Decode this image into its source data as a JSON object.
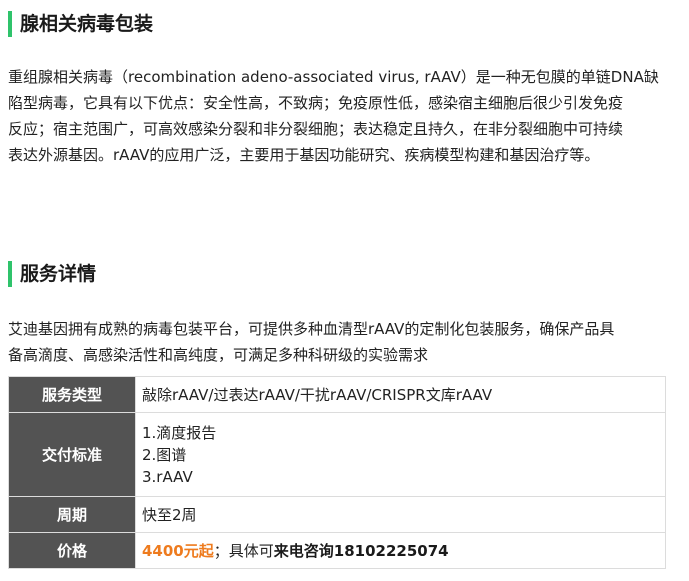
{
  "intro": {
    "title": "腺相关病毒包装",
    "paragraph_lines": [
      "重组腺相关病毒（recombination adeno-associated virus, rAAV）是一种无包膜的单链DNA缺",
      "陷型病毒，它具有以下优点：安全性高，不致病；免疫原性低，感染宿主细胞后很少引发免疫",
      "反应；宿主范围广，可高效感染分裂和非分裂细胞；表达稳定且持久，在非分裂细胞中可持续",
      "表达外源基因。rAAV的应用广泛，主要用于基因功能研究、疾病模型构建和基因治疗等。"
    ]
  },
  "service": {
    "title": "服务详情",
    "paragraph_lines": [
      "艾迪基因拥有成熟的病毒包装平台，可提供多种血清型rAAV的定制化包装服务，确保产品具",
      "备高滴度、高感染活性和高纯度，可满足多种科研级的实验需求"
    ],
    "table": {
      "type_label": "服务类型",
      "type_value": "敲除rAAV/过表达rAAV/干扰rAAV/CRISPR文库rAAV",
      "delivery_label": "交付标准",
      "delivery_items": [
        "1.滴度报告",
        "2.图谱",
        "3.rAAV"
      ],
      "period_label": "周期",
      "period_value": "快至2周",
      "price_label": "价格",
      "price_amount": "4400元起",
      "price_separator": "；具体可",
      "price_contact": "来电咨询18102225074"
    }
  },
  "colors": {
    "accent_green": "#2fc36b",
    "label_bg": "#535353",
    "price_orange": "#ee7b1e"
  }
}
